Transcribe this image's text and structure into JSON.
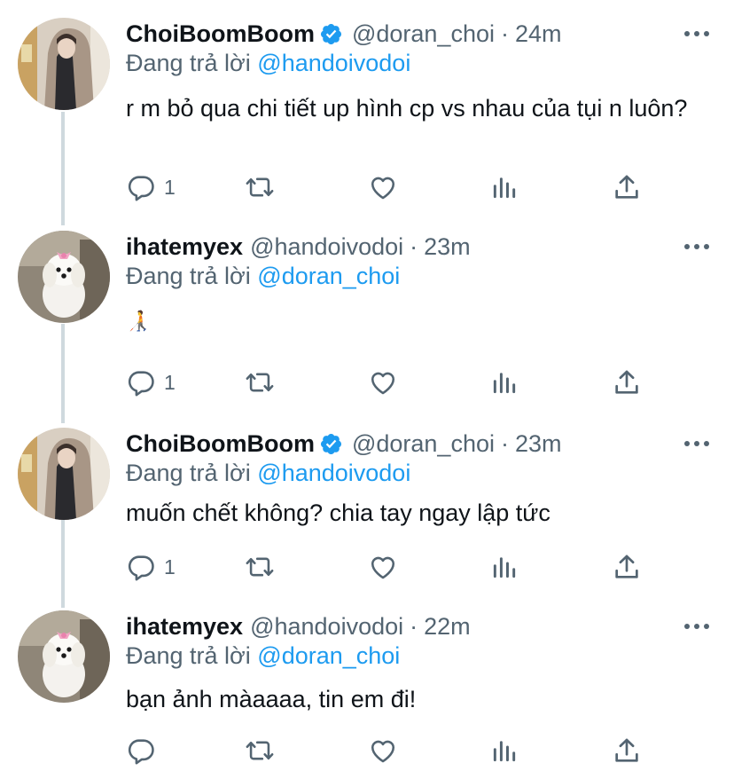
{
  "tweets": [
    {
      "display_name": "ChoiBoomBoom",
      "verified": true,
      "handle": "@doran_choi",
      "separator": "·",
      "time": "24m",
      "reply_prefix": "Đang trả lời",
      "reply_to": "@handoivodoi",
      "text": "r m bỏ qua chi tiết up hình cp vs nhau của tụi n luôn?",
      "reply_count": "1",
      "avatar": "girl-hoodie-avatar"
    },
    {
      "display_name": "ihatemyex",
      "verified": false,
      "handle": "@handoivodoi",
      "separator": "·",
      "time": "23m",
      "reply_prefix": "Đang trả lời",
      "reply_to": "@doran_choi",
      "text": "🧑‍🦯",
      "reply_count": "1",
      "avatar": "white-puppy-avatar"
    },
    {
      "display_name": "ChoiBoomBoom",
      "verified": true,
      "handle": "@doran_choi",
      "separator": "·",
      "time": "23m",
      "reply_prefix": "Đang trả lời",
      "reply_to": "@handoivodoi",
      "text": "muốn chết không? chia tay ngay lập tức",
      "reply_count": "1",
      "avatar": "girl-hoodie-avatar"
    },
    {
      "display_name": "ihatemyex",
      "verified": false,
      "handle": "@handoivodoi",
      "separator": "·",
      "time": "22m",
      "reply_prefix": "Đang trả lời",
      "reply_to": "@doran_choi",
      "text": "bạn ảnh màaaaa, tin em đi!",
      "reply_count": "",
      "avatar": "white-puppy-avatar"
    }
  ],
  "icons": {
    "reply": "reply-icon",
    "retweet": "retweet-icon",
    "like": "like-icon",
    "analytics": "analytics-icon",
    "share": "share-icon",
    "more": "more-icon",
    "verified": "verified-badge-icon"
  },
  "colors": {
    "text": "#0f1419",
    "secondary": "#536471",
    "accent": "#1d9bf0",
    "thread_line": "#cfd9de"
  }
}
